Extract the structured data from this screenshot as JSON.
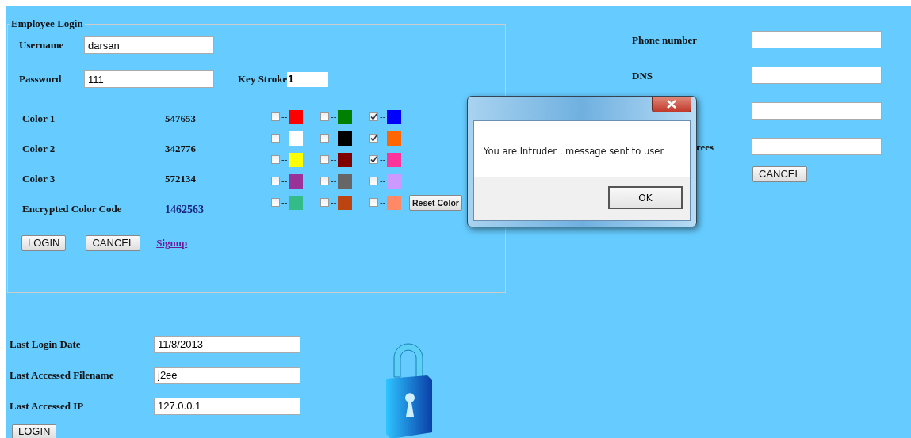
{
  "login_panel": {
    "legend": "Employee Login",
    "username": {
      "label": "Username",
      "value": "darsan"
    },
    "password": {
      "label": "Password",
      "value": "111"
    },
    "key_stroke": {
      "label": "Key Stroke",
      "value": "1"
    },
    "color_codes": [
      {
        "label": "Color 1",
        "value": "547653",
        "kind": "plain"
      },
      {
        "label": "Color 2",
        "value": "342776",
        "kind": "plain"
      },
      {
        "label": "Color 3",
        "value": "572134",
        "kind": "plain"
      },
      {
        "label": "Encrypted Color Code",
        "value": "1462563",
        "kind": "encrypted"
      }
    ],
    "color_grid": [
      [
        {
          "color": "#ff0000",
          "checked": false
        },
        {
          "color": "#008000",
          "checked": false
        },
        {
          "color": "#0000ff",
          "checked": true
        }
      ],
      [
        {
          "color": "#ffffff",
          "checked": false
        },
        {
          "color": "#000000",
          "checked": false
        },
        {
          "color": "#ff6600",
          "checked": true
        }
      ],
      [
        {
          "color": "#ffff00",
          "checked": false
        },
        {
          "color": "#800000",
          "checked": false
        },
        {
          "color": "#ff3399",
          "checked": true
        }
      ],
      [
        {
          "color": "#993399",
          "checked": false
        },
        {
          "color": "#666666",
          "checked": false
        },
        {
          "color": "#cc99ff",
          "checked": false
        }
      ],
      [
        {
          "color": "#33bb88",
          "checked": false
        },
        {
          "color": "#bb4411",
          "checked": false
        },
        {
          "color": "#ff8866",
          "checked": false
        }
      ]
    ],
    "separator": "--",
    "reset_button": "Reset Color",
    "login_button": "LOGIN",
    "cancel_button": "CANCEL",
    "signup_link": "Signup"
  },
  "last_access": {
    "fields": [
      {
        "label": "Last Login Date",
        "value": "11/8/2013"
      },
      {
        "label": "Last Accessed Filename",
        "value": "j2ee"
      },
      {
        "label": "Last Accessed IP",
        "value": "127.0.0.1"
      }
    ],
    "login_button": "LOGIN"
  },
  "right_form": {
    "fields": [
      {
        "label": "Phone number",
        "kind": "labeled"
      },
      {
        "label": "DNS",
        "kind": "labeled"
      },
      {
        "kind": "unlabeled"
      },
      {
        "label": "rees",
        "kind": "partly_hidden"
      }
    ],
    "cancel_button": "CANCEL"
  },
  "dialog": {
    "message": "You are Intruder . message sent to user",
    "ok_button": "OK"
  }
}
